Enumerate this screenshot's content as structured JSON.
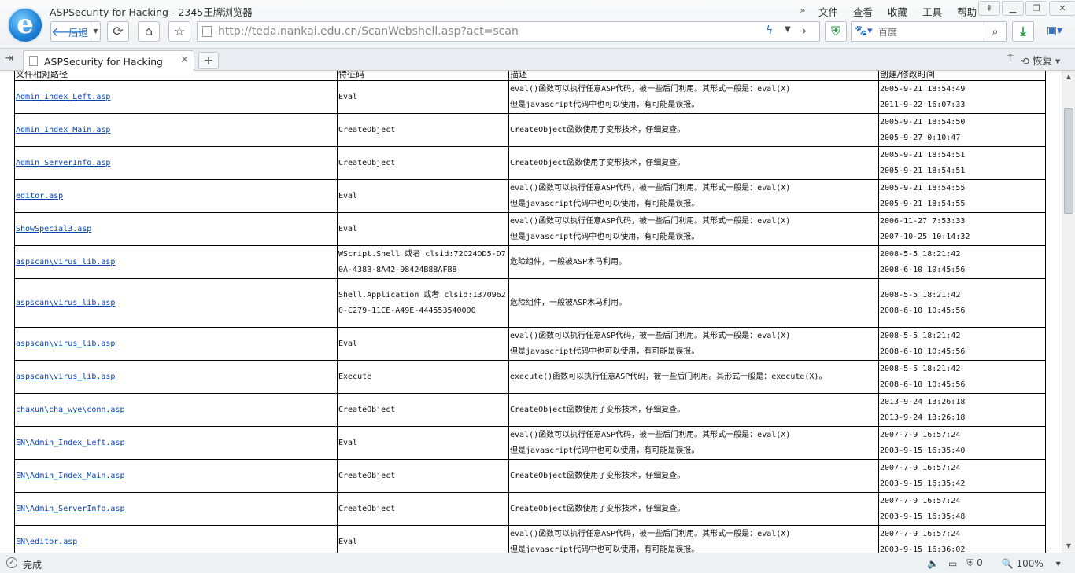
{
  "window": {
    "title": "ASPSecurity for Hacking - 2345王牌浏览器",
    "menu": [
      "文件",
      "查看",
      "收藏",
      "工具",
      "帮助"
    ],
    "overflow_glyph": "»"
  },
  "nav": {
    "back_label": "后退",
    "url_host": "http://teda.nankai.edu.cn",
    "url_path": "/ScanWebshell.asp?act=scan",
    "search_placeholder": "百度"
  },
  "tabs": {
    "active_label": "ASPSecurity for Hacking",
    "new_tab": "+",
    "restore_label": "恢复"
  },
  "table": {
    "headers": [
      "文件相对路径",
      "特征码",
      "描述",
      "创建/修改时间"
    ],
    "rows": [
      {
        "path": "Admin_Index_Left.asp",
        "sig": "Eval",
        "desc1": "eval()函数可以执行任意ASP代码，被一些后门利用。其形式一般是：eval(X)",
        "desc2": "但是javascript代码中也可以使用，有可能是误报。",
        "created": "2005-9-21 18:54:49",
        "modified": "2011-9-22 16:07:33"
      },
      {
        "path": "Admin_Index_Main.asp",
        "sig": "CreateObject",
        "desc1": "CreateObject函数使用了变形技术，仔细复查。",
        "desc2": "",
        "created": "2005-9-21 18:54:50",
        "modified": "2005-9-27 0:10:47"
      },
      {
        "path": "Admin_ServerInfo.asp",
        "sig": "CreateObject",
        "desc1": "CreateObject函数使用了变形技术，仔细复查。",
        "desc2": "",
        "created": "2005-9-21 18:54:51",
        "modified": "2005-9-21 18:54:51"
      },
      {
        "path": "editor.asp",
        "sig": "Eval",
        "desc1": "eval()函数可以执行任意ASP代码，被一些后门利用。其形式一般是：eval(X)",
        "desc2": "但是javascript代码中也可以使用，有可能是误报。",
        "created": "2005-9-21 18:54:55",
        "modified": "2005-9-21 18:54:55"
      },
      {
        "path": "ShowSpecial3.asp",
        "sig": "Eval",
        "desc1": "eval()函数可以执行任意ASP代码，被一些后门利用。其形式一般是：eval(X)",
        "desc2": "但是javascript代码中也可以使用，有可能是误报。",
        "created": "2006-11-27 7:53:33",
        "modified": "2007-10-25 10:14:32"
      },
      {
        "path": "aspscan\\virus_lib.asp",
        "sig": "WScript.Shell 或者 clsid:72C24DD5-D70A-438B-8A42-98424B88AFB8",
        "desc1": "危险组件，一般被ASP木马利用。",
        "desc2": "",
        "created": "2008-5-5 18:21:42",
        "modified": "2008-6-10 10:45:56"
      },
      {
        "path": "aspscan\\virus_lib.asp",
        "sig": "Shell.Application 或者 clsid:13709620-C279-11CE-A49E-444553540000",
        "desc1": "危险组件，一般被ASP木马利用。",
        "desc2": "",
        "created": "2008-5-5 18:21:42",
        "modified": "2008-6-10 10:45:56",
        "tall": true
      },
      {
        "path": "aspscan\\virus_lib.asp",
        "sig": "Eval",
        "desc1": "eval()函数可以执行任意ASP代码，被一些后门利用。其形式一般是：eval(X)",
        "desc2": "但是javascript代码中也可以使用，有可能是误报。",
        "created": "2008-5-5 18:21:42",
        "modified": "2008-6-10 10:45:56"
      },
      {
        "path": "aspscan\\virus_lib.asp",
        "sig": "Execute",
        "desc1": "execute()函数可以执行任意ASP代码，被一些后门利用。其形式一般是：execute(X)。",
        "desc2": "",
        "created": "2008-5-5 18:21:42",
        "modified": "2008-6-10 10:45:56"
      },
      {
        "path": "chaxun\\cha_wye\\conn.asp",
        "sig": "CreateObject",
        "desc1": "CreateObject函数使用了变形技术，仔细复查。",
        "desc2": "",
        "created": "2013-9-24 13:26:18",
        "modified": "2013-9-24 13:26:18"
      },
      {
        "path": "EN\\Admin_Index_Left.asp",
        "sig": "Eval",
        "desc1": "eval()函数可以执行任意ASP代码，被一些后门利用。其形式一般是：eval(X)",
        "desc2": "但是javascript代码中也可以使用，有可能是误报。",
        "created": "2007-7-9 16:57:24",
        "modified": "2003-9-15 16:35:40"
      },
      {
        "path": "EN\\Admin_Index_Main.asp",
        "sig": "CreateObject",
        "desc1": "CreateObject函数使用了变形技术，仔细复查。",
        "desc2": "",
        "created": "2007-7-9 16:57:24",
        "modified": "2003-9-15 16:35:42"
      },
      {
        "path": "EN\\Admin_ServerInfo.asp",
        "sig": "CreateObject",
        "desc1": "CreateObject函数使用了变形技术，仔细复查。",
        "desc2": "",
        "created": "2007-7-9 16:57:24",
        "modified": "2003-9-15 16:35:48"
      },
      {
        "path": "EN\\editor.asp",
        "sig": "Eval",
        "desc1": "eval()函数可以执行任意ASP代码，被一些后门利用。其形式一般是：eval(X)",
        "desc2": "但是javascript代码中也可以使用，有可能是误报。",
        "created": "2007-7-9 16:57:24",
        "modified": "2003-9-15 16:36:02"
      }
    ]
  },
  "status": {
    "text": "完成",
    "security_count": "0",
    "zoom": "100%"
  },
  "colors": {
    "link": "#0645ad",
    "accent": "#2b74c8"
  }
}
